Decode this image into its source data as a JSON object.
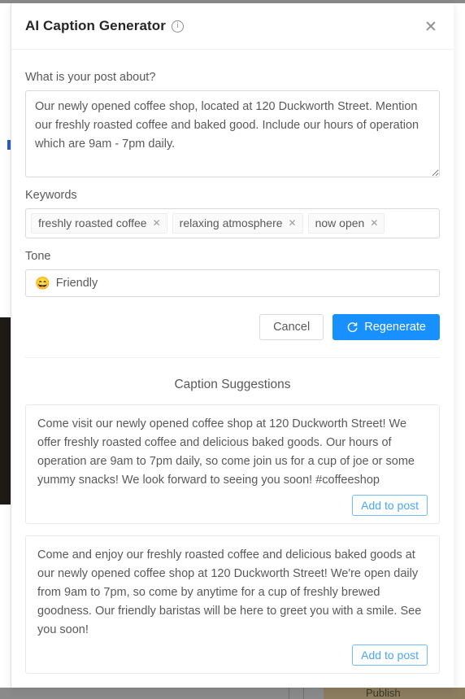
{
  "modal": {
    "title": "AI Caption Generator",
    "info_icon": "info-circle-icon",
    "close_label": "✕"
  },
  "form": {
    "post_label": "What is your post about?",
    "post_value": "Our newly opened coffee shop, located at 120 Duckworth Street. Mention our freshly roasted coffee and baked good. Include our hours of operation which are 9am - 7pm daily.",
    "post_placeholder": "What is your post about?",
    "keywords_label": "Keywords",
    "keywords": [
      {
        "label": "freshly roasted coffee",
        "remove": "✕"
      },
      {
        "label": "relaxing atmosphere",
        "remove": "✕"
      },
      {
        "label": "now open",
        "remove": "✕"
      }
    ],
    "keywords_placeholder": "",
    "tone_label": "Tone",
    "tone_emoji": "😄",
    "tone_value": "Friendly"
  },
  "actions": {
    "cancel_label": "Cancel",
    "regenerate_label": "Regenerate",
    "regenerate_icon": "refresh-icon"
  },
  "suggestions": {
    "heading": "Caption Suggestions",
    "items": [
      {
        "text": "Come visit our newly opened coffee shop at 120 Duckworth Street! We offer freshly roasted coffee and delicious baked goods. Our hours of operation are 9am to 7pm daily, so come join us for a cup of joe or some yummy snacks! We look forward to seeing you soon! #coffeeshop",
        "add_label": "Add to post"
      },
      {
        "text": "Come and enjoy our freshly roasted coffee and delicious baked goods at our newly opened coffee shop at 120 Duckworth Street! We're open daily from 9am to 7pm, so come by anytime for a cup of freshly brewed goodness. Our friendly baristas will be here to greet you with a smile. See you soon!",
        "add_label": "Add to post"
      }
    ]
  },
  "background": {
    "bottom_bar_text": "Publish",
    "accent_color": "#1890ff",
    "link_color": "#49a8f5"
  }
}
